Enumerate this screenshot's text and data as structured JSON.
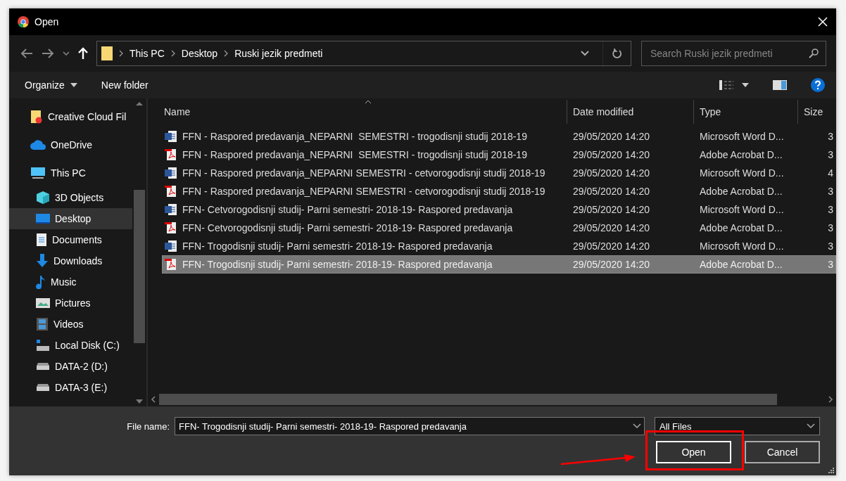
{
  "window": {
    "title": "Open"
  },
  "nav": {
    "breadcrumbs": [
      "This PC",
      "Desktop",
      "Ruski jezik predmeti"
    ],
    "search_placeholder": "Search Ruski jezik predmeti"
  },
  "toolbar": {
    "organize": "Organize",
    "new_folder": "New folder"
  },
  "sidebar": {
    "items": [
      {
        "label": "Creative Cloud Fil",
        "kind": "cc",
        "selected": false
      },
      {
        "label": "OneDrive",
        "kind": "cloud",
        "selected": false
      },
      {
        "label": "This PC",
        "kind": "pc",
        "selected": false,
        "children": [
          {
            "label": "3D Objects",
            "kind": "cube",
            "selected": false
          },
          {
            "label": "Desktop",
            "kind": "desktop",
            "selected": true
          },
          {
            "label": "Documents",
            "kind": "doc",
            "selected": false
          },
          {
            "label": "Downloads",
            "kind": "down",
            "selected": false
          },
          {
            "label": "Music",
            "kind": "music",
            "selected": false
          },
          {
            "label": "Pictures",
            "kind": "pics",
            "selected": false
          },
          {
            "label": "Videos",
            "kind": "video",
            "selected": false
          },
          {
            "label": "Local Disk (C:)",
            "kind": "sysdisk",
            "selected": false
          },
          {
            "label": "DATA-2 (D:)",
            "kind": "disk",
            "selected": false
          },
          {
            "label": "DATA-3 (E:)",
            "kind": "disk",
            "selected": false
          }
        ]
      }
    ]
  },
  "table": {
    "columns": [
      {
        "label": "Name",
        "sorted": true
      },
      {
        "label": "Date modified",
        "sorted": false
      },
      {
        "label": "Type",
        "sorted": false
      },
      {
        "label": "Size",
        "sorted": false
      }
    ],
    "rows": [
      {
        "kind": "word",
        "name": "FFN - Raspored predavanja_NEPARNI  SEMESTRI - trogodisnji studij 2018-19",
        "date": "29/05/2020 14:20",
        "type": "Microsoft Word D...",
        "size": "3",
        "selected": false
      },
      {
        "kind": "pdf",
        "name": "FFN - Raspored predavanja_NEPARNI  SEMESTRI - trogodisnji studij 2018-19",
        "date": "29/05/2020 14:20",
        "type": "Adobe Acrobat D...",
        "size": "3",
        "selected": false
      },
      {
        "kind": "word",
        "name": "FFN - Raspored predavanja_NEPARNI SEMESTRI - cetvorogodisnji studij 2018-19",
        "date": "29/05/2020 14:20",
        "type": "Microsoft Word D...",
        "size": "4",
        "selected": false
      },
      {
        "kind": "pdf",
        "name": "FFN - Raspored predavanja_NEPARNI SEMESTRI - cetvorogodisnji studij 2018-19",
        "date": "29/05/2020 14:20",
        "type": "Adobe Acrobat D...",
        "size": "3",
        "selected": false
      },
      {
        "kind": "word",
        "name": "FFN- Cetvorogodisnji studij- Parni semestri- 2018-19- Raspored predavanja",
        "date": "29/05/2020 14:20",
        "type": "Microsoft Word D...",
        "size": "3",
        "selected": false
      },
      {
        "kind": "pdf",
        "name": "FFN- Cetvorogodisnji studij- Parni semestri- 2018-19- Raspored predavanja",
        "date": "29/05/2020 14:20",
        "type": "Adobe Acrobat D...",
        "size": "3",
        "selected": false
      },
      {
        "kind": "word",
        "name": "FFN- Trogodisnji studij- Parni semestri- 2018-19- Raspored predavanja",
        "date": "29/05/2020 14:20",
        "type": "Microsoft Word D...",
        "size": "3",
        "selected": false
      },
      {
        "kind": "pdf",
        "name": "FFN- Trogodisnji studij- Parni semestri- 2018-19- Raspored predavanja",
        "date": "29/05/2020 14:20",
        "type": "Adobe Acrobat D...",
        "size": "3",
        "selected": true
      }
    ]
  },
  "footer": {
    "file_name_label": "File name:",
    "file_name": "FFN- Trogodisnji studij- Parni semestri- 2018-19- Raspored predavanja",
    "filter": "All Files",
    "buttons": [
      {
        "label": "Open",
        "highlighted": true
      },
      {
        "label": "Cancel",
        "highlighted": false
      }
    ]
  }
}
